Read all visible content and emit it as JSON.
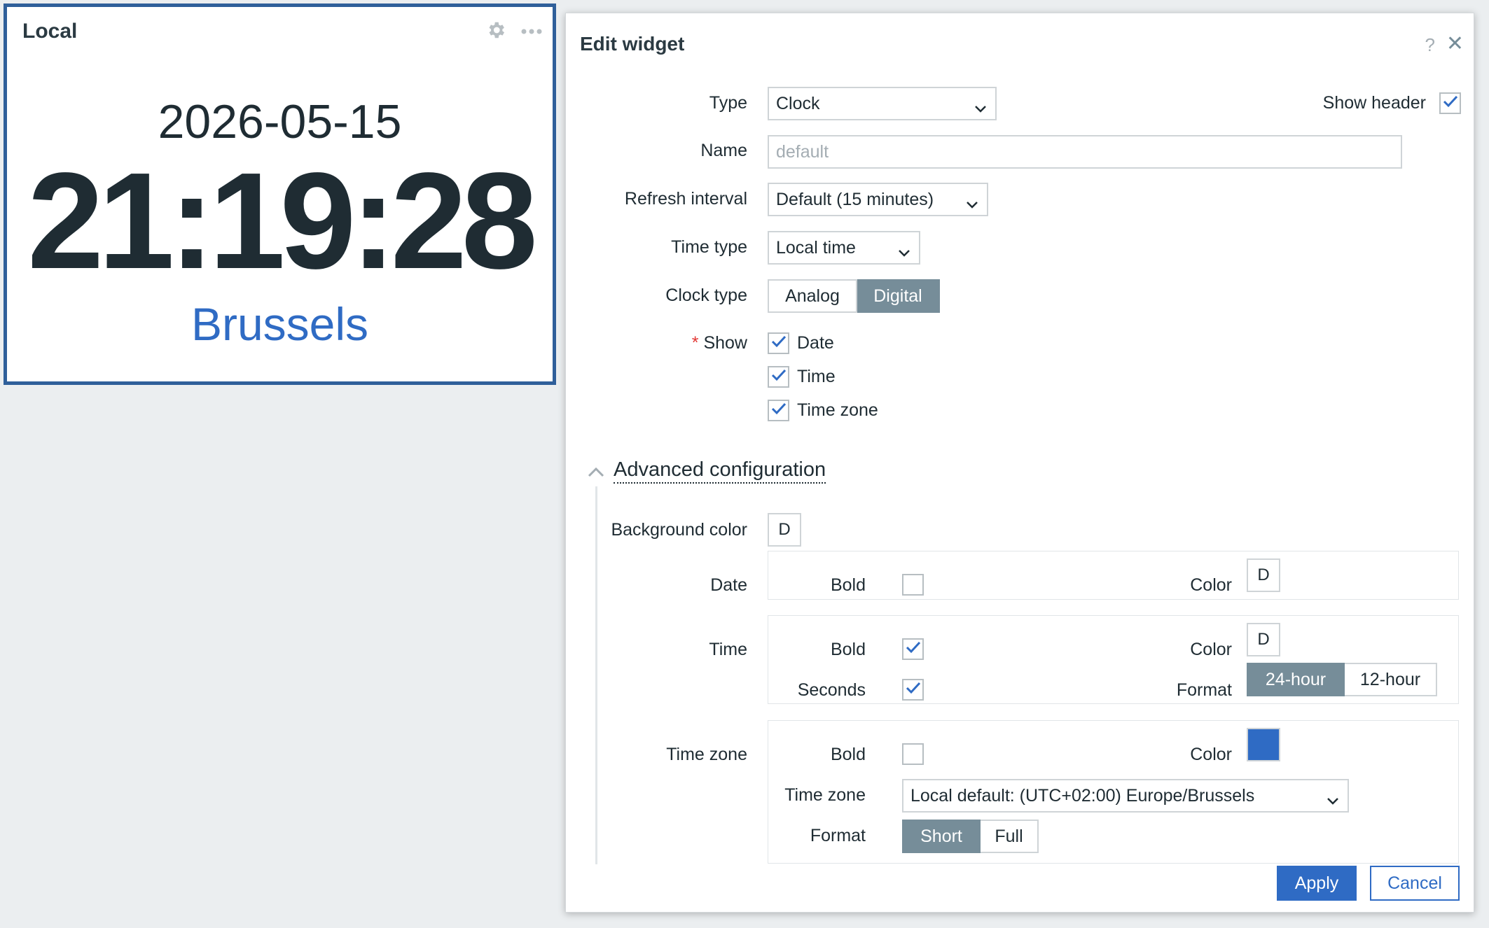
{
  "widget": {
    "title": "Local",
    "date": "2026-05-15",
    "time": "21:19:28",
    "timezone": "Brussels"
  },
  "dialog": {
    "title": "Edit widget",
    "help": "?",
    "close": "✕"
  },
  "form": {
    "type_label": "Type",
    "type_value": "Clock",
    "show_header_label": "Show header",
    "show_header_checked": true,
    "name_label": "Name",
    "name_placeholder": "default",
    "refresh_label": "Refresh interval",
    "refresh_value": "Default (15 minutes)",
    "time_type_label": "Time type",
    "time_type_value": "Local time",
    "clock_type_label": "Clock type",
    "clock_type_options": [
      "Analog",
      "Digital"
    ],
    "clock_type_selected": "Digital",
    "show_required_mark": "*",
    "show_label": "Show",
    "show_options": [
      {
        "label": "Date",
        "checked": true
      },
      {
        "label": "Time",
        "checked": true
      },
      {
        "label": "Time zone",
        "checked": true
      }
    ]
  },
  "advanced": {
    "title": "Advanced configuration",
    "background_color_label": "Background color",
    "background_color_value": "D",
    "date": {
      "label": "Date",
      "bold_label": "Bold",
      "bold_checked": false,
      "color_label": "Color",
      "color_value": "D"
    },
    "time": {
      "label": "Time",
      "bold_label": "Bold",
      "bold_checked": true,
      "color_label": "Color",
      "color_value": "D",
      "seconds_label": "Seconds",
      "seconds_checked": true,
      "format_label": "Format",
      "format_options": [
        "24-hour",
        "12-hour"
      ],
      "format_selected": "24-hour"
    },
    "timezone": {
      "label": "Time zone",
      "bold_label": "Bold",
      "bold_checked": false,
      "color_label": "Color",
      "color_value": "#2f6bc4",
      "tz_label": "Time zone",
      "tz_value": "Local default: (UTC+02:00) Europe/Brussels",
      "format_label": "Format",
      "format_options": [
        "Short",
        "Full"
      ],
      "format_selected": "Short"
    }
  },
  "buttons": {
    "apply": "Apply",
    "cancel": "Cancel"
  },
  "colors": {
    "accent": "#2f6bc4",
    "widget_border": "#2f5f9a",
    "segment_active": "#768d99",
    "page_bg": "#ebeef0"
  }
}
